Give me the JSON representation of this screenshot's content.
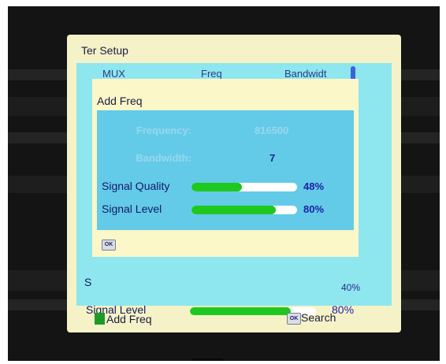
{
  "ter_setup": {
    "title": "Ter Setup",
    "columns": [
      "MUX",
      "Freq",
      "Bandwidt"
    ],
    "background_rows": {
      "signal_quality_prefix": "S",
      "signal_quality_value_partial": "40%",
      "signal_level_label": "Signal Level",
      "signal_level_value": "80%",
      "signal_level_fraction": 0.8
    }
  },
  "add_freq_dialog": {
    "title": "Add Freq",
    "frequency_label": "Frequency:",
    "frequency_value": "816500",
    "bandwidth_label": "Bandwidth:",
    "bandwidth_value": "7",
    "signal_quality_label": "Signal Quality",
    "signal_quality_value": "48%",
    "signal_quality_fraction": 0.48,
    "signal_level_label": "Signal Level",
    "signal_level_value": "80%",
    "signal_level_fraction": 0.8,
    "ok_icon_text": "OK"
  },
  "footer": {
    "add_freq_label": "Add Freq",
    "ok_icon_text": "OK",
    "search_label": "Search"
  },
  "colors": {
    "panel_background": "#8ee6ee",
    "dialog_background": "#fbf7c8",
    "bar_fill": "#1fc81f",
    "green_key": "#1d9a2a"
  },
  "icons": [
    "ok-button-icon",
    "green-key-icon"
  ]
}
